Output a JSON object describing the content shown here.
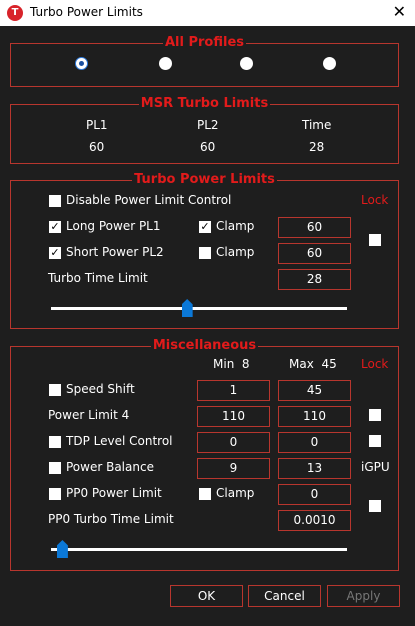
{
  "window": {
    "title": "Turbo Power Limits",
    "app_icon_letter": "T",
    "close_glyph": "✕"
  },
  "all_profiles": {
    "legend": "All Profiles",
    "selected_index": 0,
    "radio_count": 4
  },
  "msr": {
    "legend": "MSR Turbo Limits",
    "headers": [
      "PL1",
      "PL2",
      "Time"
    ],
    "values": [
      "60",
      "60",
      "28"
    ]
  },
  "turbo": {
    "legend": "Turbo Power Limits",
    "lock_label": "Lock",
    "disable_label": "Disable Power Limit Control",
    "long_label": "Long Power PL1",
    "short_label": "Short Power PL2",
    "clamp_label": "Clamp",
    "turbo_time_label": "Turbo Time Limit",
    "long_value": "60",
    "short_value": "60",
    "time_value": "28",
    "disable_checked": false,
    "long_checked": true,
    "short_checked": true,
    "long_clamp_checked": true,
    "short_clamp_checked": false,
    "lock_checked": false,
    "slider_fraction": 0.46
  },
  "misc": {
    "legend": "Miscellaneous",
    "min_label": "Min  8",
    "max_label": "Max  45",
    "lock_label": "Lock",
    "speed_shift_label": "Speed Shift",
    "speed_shift_min": "1",
    "speed_shift_max": "45",
    "pl4_label": "Power Limit 4",
    "pl4_min": "110",
    "pl4_max": "110",
    "tdp_label": "TDP Level Control",
    "tdp_min": "0",
    "tdp_max": "0",
    "balance_label": "Power Balance",
    "balance_min": "9",
    "balance_max": "13",
    "igpu_label": "iGPU",
    "pp0_label": "PP0 Power Limit",
    "pp0_clamp_label": "Clamp",
    "pp0_value": "0",
    "pp0_time_label": "PP0 Turbo Time Limit",
    "pp0_time_value": "0.0010",
    "slider_fraction": 0.02
  },
  "buttons": {
    "ok": "OK",
    "cancel": "Cancel",
    "apply": "Apply"
  },
  "colors": {
    "accent": "#e21b1b",
    "border": "#b8362e",
    "background": "#1e1e1e",
    "slider_thumb": "#0b78d7"
  },
  "icons": {
    "app": "throttlestop-icon",
    "close": "close-icon"
  }
}
